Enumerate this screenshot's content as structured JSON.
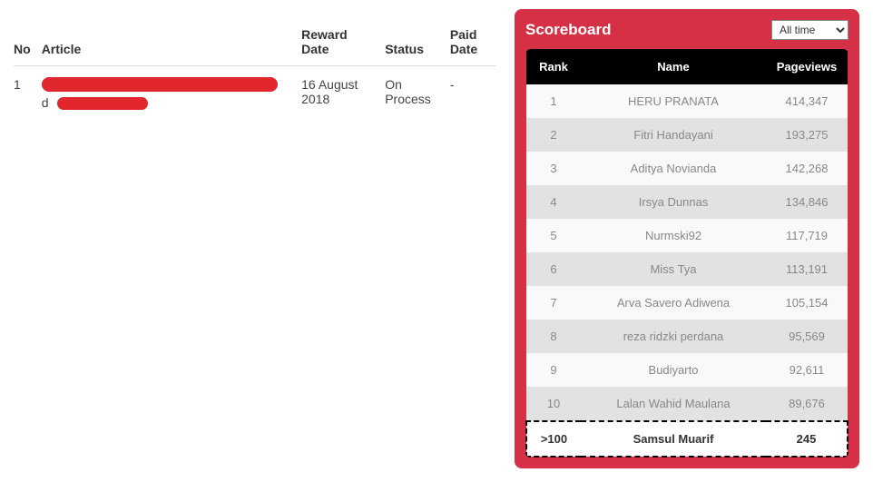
{
  "left_table": {
    "headers": {
      "no": "No",
      "article": "Article",
      "reward_date": "Reward Date",
      "status": "Status",
      "paid_date": "Paid Date"
    },
    "rows": [
      {
        "no": "1",
        "article_prefix": "d",
        "reward_date": "16 August 2018",
        "status": "On Process",
        "paid_date": "-"
      }
    ]
  },
  "scoreboard": {
    "title": "Scoreboard",
    "period_selected": "All time",
    "headers": {
      "rank": "Rank",
      "name": "Name",
      "pageviews": "Pageviews"
    },
    "rows": [
      {
        "rank": "1",
        "name": "HERU PRANATA",
        "pageviews": "414,347"
      },
      {
        "rank": "2",
        "name": "Fitri Handayani",
        "pageviews": "193,275"
      },
      {
        "rank": "3",
        "name": "Aditya Novianda",
        "pageviews": "142,268"
      },
      {
        "rank": "4",
        "name": "Irsya Dunnas",
        "pageviews": "134,846"
      },
      {
        "rank": "5",
        "name": "Nurmski92",
        "pageviews": "117,719"
      },
      {
        "rank": "6",
        "name": "Miss Tya",
        "pageviews": "113,191"
      },
      {
        "rank": "7",
        "name": "Arva Savero Adiwena",
        "pageviews": "105,154"
      },
      {
        "rank": "8",
        "name": "reza ridzki perdana",
        "pageviews": "95,569"
      },
      {
        "rank": "9",
        "name": "Budiyarto",
        "pageviews": "92,611"
      },
      {
        "rank": "10",
        "name": "Lalan Wahid Maulana",
        "pageviews": "89,676"
      }
    ],
    "user_row": {
      "rank": ">100",
      "name": "Samsul Muarif",
      "pageviews": "245"
    }
  }
}
